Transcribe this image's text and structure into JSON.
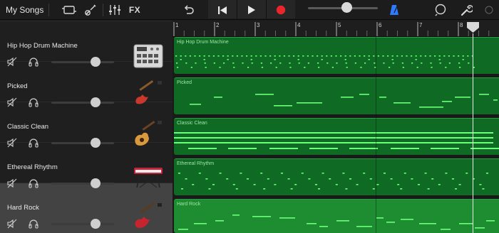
{
  "toolbar": {
    "my_songs": "My Songs",
    "fx": "FX",
    "icons": [
      "tracks-view-icon",
      "instrument-icon",
      "mixer-icon",
      "undo-icon",
      "rewind-icon",
      "play-icon",
      "record-icon",
      "metronome-icon",
      "loop-icon",
      "settings-icon"
    ],
    "record_color": "#e8262b",
    "metronome_color": "#2f7bff",
    "master_volume": 0.55
  },
  "ruler": {
    "bars": [
      "1",
      "2",
      "3",
      "4",
      "5",
      "6",
      "7",
      "8"
    ]
  },
  "tracks": [
    {
      "name": "Hip Hop Drum Machine",
      "region": "Hip Hop Drum Machine",
      "instrument": "drum-machine-icon",
      "volume": 0.7,
      "selected": false
    },
    {
      "name": "Picked",
      "region": "Picked",
      "instrument": "bass-guitar-icon",
      "volume": 0.7,
      "selected": false
    },
    {
      "name": "Classic Clean",
      "region": "Classic Clean",
      "instrument": "acoustic-guitar-icon",
      "volume": 0.7,
      "selected": false
    },
    {
      "name": "Ethereal Rhythm",
      "region": "Ethereal Rhythm",
      "instrument": "keyboard-icon",
      "volume": 0.7,
      "selected": false
    },
    {
      "name": "Hard Rock",
      "region": "Hard Rock",
      "instrument": "electric-guitar-icon",
      "volume": 0.7,
      "selected": true
    }
  ],
  "colors": {
    "region": "#0f6a24",
    "region_selected": "#1e8d32",
    "note": "#6bff7a"
  }
}
